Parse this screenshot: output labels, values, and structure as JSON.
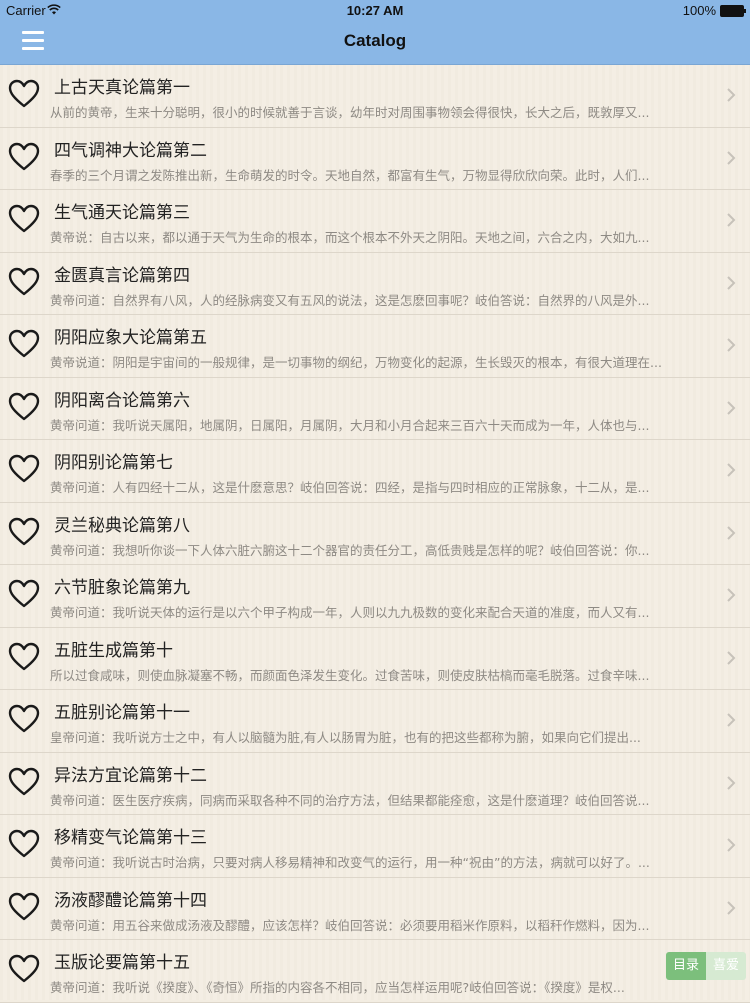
{
  "status": {
    "carrier": "Carrier",
    "time": "10:27 AM",
    "battery": "100%"
  },
  "nav": {
    "title": "Catalog"
  },
  "chapters": [
    {
      "title": "上古天真论篇第一",
      "summary": "从前的黄帝，生来十分聪明，很小的时候就善于言谈，幼年时对周围事物领会得很快，长大之后，既敦厚又..."
    },
    {
      "title": "四气调神大论篇第二",
      "summary": "春季的三个月谓之发陈推出新，生命萌发的时令。天地自然，都富有生气，万物显得欣欣向荣。此时，人们..."
    },
    {
      "title": "生气通天论篇第三",
      "summary": "黄帝说：自古以来，都以通于天气为生命的根本，而这个根本不外天之阴阳。天地之间，六合之内，大如九..."
    },
    {
      "title": "金匮真言论篇第四",
      "summary": "黄帝问道：自然界有八风，人的经脉病变又有五风的说法，这是怎麽回事呢？岐伯答说：自然界的八风是外..."
    },
    {
      "title": "阴阳应象大论篇第五",
      "summary": "黄帝说道：阴阳是宇宙间的一般规律，是一切事物的纲纪，万物变化的起源，生长毁灭的根本，有很大道理在..."
    },
    {
      "title": "阴阳离合论篇第六",
      "summary": "黄帝问道：我听说天属阳，地属阴，日属阳，月属阴，大月和小月合起来三百六十天而成为一年，人体也与..."
    },
    {
      "title": "阴阳别论篇第七",
      "summary": "黄帝问道：人有四经十二从，这是什麽意思？岐伯回答说：四经，是指与四时相应的正常脉象，十二从，是..."
    },
    {
      "title": "灵兰秘典论篇第八",
      "summary": "黄帝问道：我想听你谈一下人体六脏六腑这十二个器官的责任分工，高低贵贱是怎样的呢？岐伯回答说：你..."
    },
    {
      "title": "六节脏象论篇第九",
      "summary": "黄帝问道：我听说天体的运行是以六个甲子构成一年，人则以九九极数的变化来配合天道的准度，而人又有..."
    },
    {
      "title": "五脏生成篇第十",
      "summary": "所以过食咸味，则使血脉凝塞不畅，而颜面色泽发生变化。过食苦味，则使皮肤枯槁而毫毛脱落。过食辛味..."
    },
    {
      "title": "五脏别论篇第十一",
      "summary": "皇帝问道：我听说方士之中，有人以脑髓为脏,有人以肠胃为脏，也有的把这些都称为腑，如果向它们提出..."
    },
    {
      "title": "异法方宜论篇第十二",
      "summary": "黄帝问道：医生医疗疾病，同病而采取各种不同的治疗方法，但结果都能痊愈，这是什麽道理？岐伯回答说..."
    },
    {
      "title": "移精变气论篇第十三",
      "summary": "黄帝问道：我听说古时治病，只要对病人移易精神和改变气的运行，用一种“祝由”的方法，病就可以好了。..."
    },
    {
      "title": "汤液醪醴论篇第十四",
      "summary": "黄帝问道：用五谷来做成汤液及醪醴，应该怎样？岐伯回答说：必须要用稻米作原料，以稻秆作燃料，因为..."
    },
    {
      "title": "玉版论要篇第十五",
      "summary": "黄帝问道：我听说《揆度》、《奇恒》所指的内容各不相同，应当怎样运用呢?岐伯回答说：《揆度》是权..."
    }
  ],
  "float_tabs": {
    "catalog": "目录",
    "favorites": "喜爱"
  },
  "colors": {
    "navbar": "#8ab7e6",
    "background": "#f4eee3",
    "tab_active": "#7cbf7c"
  },
  "icons": {
    "row_icon": "heart-outline-icon",
    "row_accessory": "chevron-right-icon",
    "menu": "hamburger-menu-icon"
  }
}
